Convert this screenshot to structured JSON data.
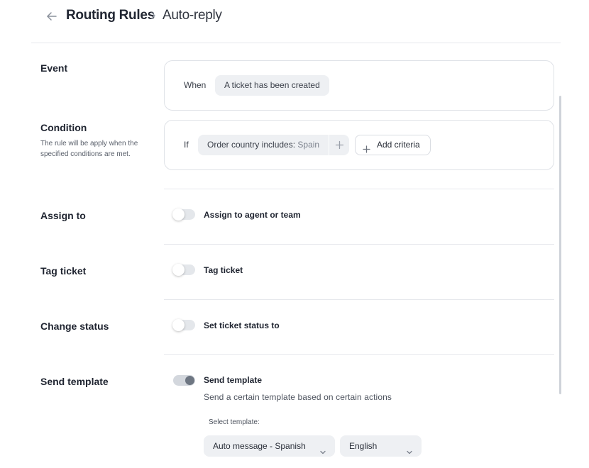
{
  "header": {
    "breadcrumb_parent": "Routing Rules",
    "breadcrumb_current": "Auto-reply"
  },
  "event": {
    "label": "Event",
    "keyword": "When",
    "trigger": "A ticket has been created"
  },
  "condition": {
    "label": "Condition",
    "description": "The rule will be apply when the specified conditions are met.",
    "keyword": "If",
    "criteria_field": "Order country includes:",
    "criteria_value": "Spain",
    "add_criteria_label": "Add criteria"
  },
  "assign": {
    "label": "Assign to",
    "toggle_label": "Assign to agent or team",
    "enabled": false
  },
  "tag": {
    "label": "Tag ticket",
    "toggle_label": "Tag ticket",
    "enabled": false
  },
  "status": {
    "label": "Change status",
    "toggle_label": "Set ticket status to",
    "enabled": false
  },
  "template": {
    "label": "Send template",
    "toggle_label": "Send template",
    "enabled": true,
    "hint": "Send a certain template based on certain actions",
    "select_label": "Select template:",
    "selected_template": "Auto message - Spanish",
    "selected_language": "English"
  },
  "icons": [
    "arrow-left-icon",
    "chevron-right-icon",
    "plus-icon",
    "chevron-down-icon"
  ],
  "colors": {
    "toggle_off": "#e4e7eb",
    "toggle_on_knob": "#6e7682",
    "chip_background": "#eef0f3",
    "text_primary": "#1f2430"
  }
}
